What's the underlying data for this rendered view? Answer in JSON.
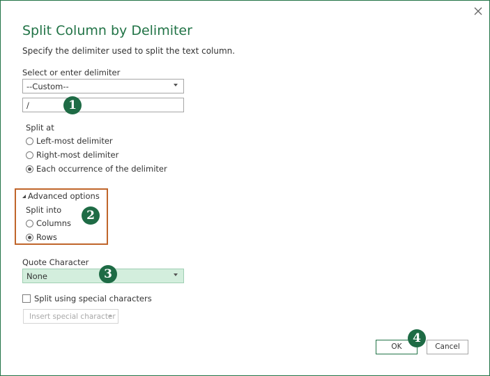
{
  "dialog": {
    "title": "Split Column by Delimiter",
    "subtitle": "Specify the delimiter used to split the text column.",
    "close_icon": "close-icon"
  },
  "delimiter": {
    "label": "Select or enter delimiter",
    "selected": "--Custom--",
    "custom_value": "/"
  },
  "split_at": {
    "label": "Split at",
    "options": [
      {
        "label": "Left-most delimiter",
        "checked": false
      },
      {
        "label": "Right-most delimiter",
        "checked": false
      },
      {
        "label": "Each occurrence of the delimiter",
        "checked": true
      }
    ]
  },
  "advanced": {
    "toggle_label": "Advanced options",
    "split_into_label": "Split into",
    "options": [
      {
        "label": "Columns",
        "checked": false
      },
      {
        "label": "Rows",
        "checked": true
      }
    ],
    "highlight_color": "#c0652a"
  },
  "quote": {
    "label": "Quote Character",
    "selected": "None",
    "highlight_color": "#d3eedd"
  },
  "special": {
    "checkbox_label": "Split using special characters",
    "checked": false,
    "insert_label": "Insert special character"
  },
  "buttons": {
    "ok": "OK",
    "cancel": "Cancel"
  },
  "badges": [
    "1",
    "2",
    "3",
    "4"
  ],
  "colors": {
    "accent": "#217346",
    "badge": "#1e6b45"
  }
}
